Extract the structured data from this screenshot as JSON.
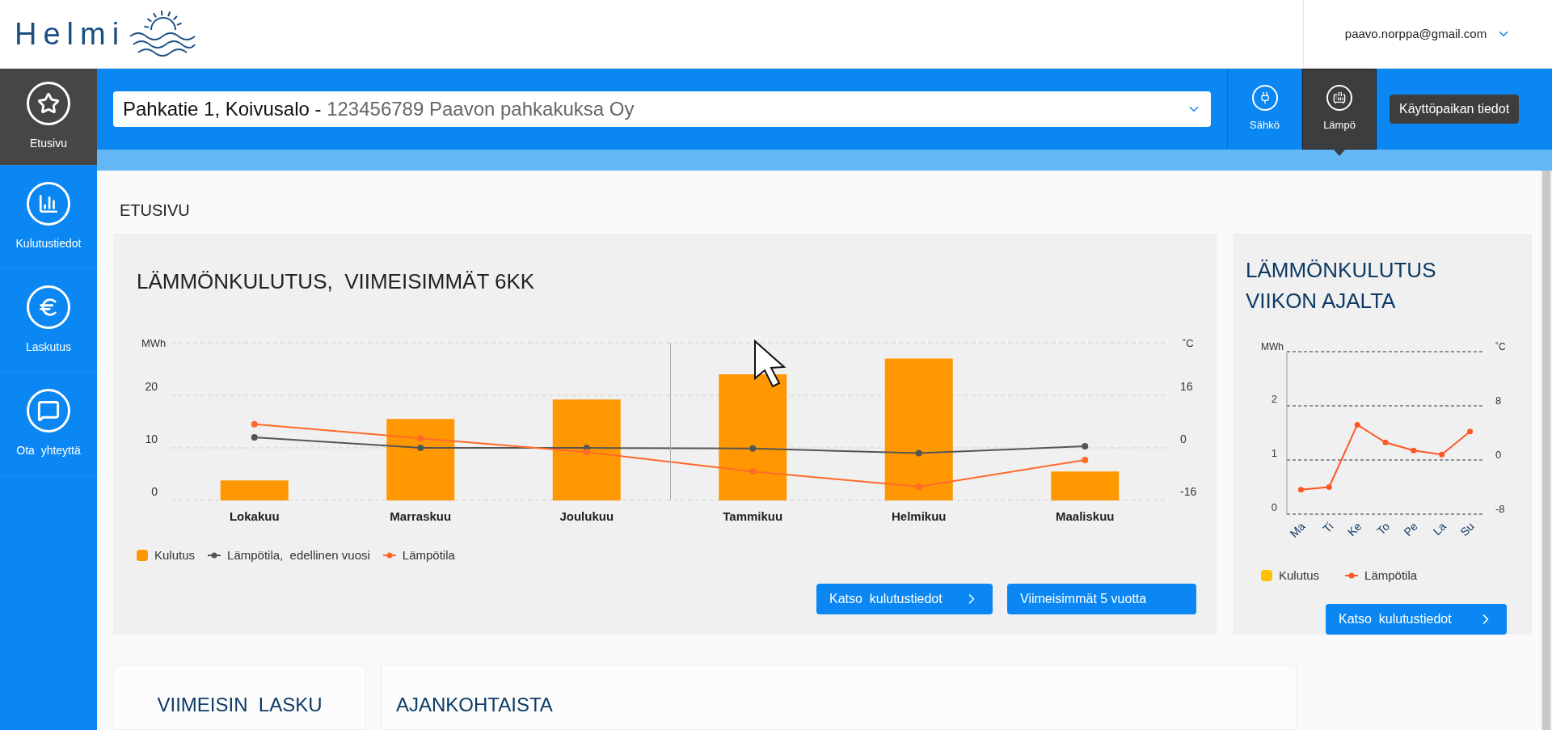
{
  "header": {
    "logo_text": "Helmi",
    "user_email": "paavo.norppa@gmail.com"
  },
  "sidebar": {
    "items": [
      {
        "label": "Etusivu",
        "selected": true
      },
      {
        "label": "Kulutustiedot",
        "selected": false
      },
      {
        "label": "Laskutus",
        "selected": false
      },
      {
        "label": "Ota  yhteyttä",
        "selected": false
      }
    ]
  },
  "location_select": {
    "address": "Pahkatie 1, Koivusalo -",
    "customer": "123456789 Paavon pahkakuksa Oy"
  },
  "energy_tabs": [
    {
      "label": "Sähkö",
      "selected": false
    },
    {
      "label": "Lämpö",
      "selected": true
    }
  ],
  "site_info_button": "Käyttöpaikan tiedot",
  "page_title": "ETUSIVU",
  "monthly_card": {
    "title": "LÄMMÖNKULUTUS,  VIIMEISIMMÄT 6KK",
    "chart_data": {
      "type": "bar",
      "ylabel": "MWh",
      "y2label": "˚C",
      "categories": [
        "Lokakuu",
        "Marraskuu",
        "Joulukuu",
        "Tammikuu",
        "Helmikuu",
        "Maaliskuu"
      ],
      "ylim": [
        0,
        30
      ],
      "yticks": [
        0,
        10,
        20
      ],
      "y2lim": [
        -16,
        32
      ],
      "y2ticks": [
        -16,
        0,
        16
      ],
      "series": [
        {
          "name": "Kulutus",
          "color": "#ff9800",
          "values": [
            3.8,
            15.5,
            19.2,
            24,
            27,
            5.5
          ]
        },
        {
          "name": "Lämpötila,  edellinen vuosi",
          "type": "line",
          "marker": true,
          "axis": "y2",
          "color": "#555555",
          "values": [
            3.2,
            0,
            0,
            -0.2,
            -1.6,
            0.5
          ]
        },
        {
          "name": "Lämpötila",
          "type": "line",
          "marker": true,
          "axis": "y2",
          "color": "#ff6a2a",
          "values": [
            7.2,
            2.9,
            -1.3,
            -7.2,
            -11.8,
            -3.7
          ]
        }
      ]
    },
    "buttons": [
      {
        "label": "Katso  kulutustiedot",
        "chevron": true
      },
      {
        "label": "Viimeisimmät 5 vuotta",
        "chevron": false
      }
    ]
  },
  "weekly_card": {
    "title": "LÄMMÖNKULUTUS VIIKON AJALTA",
    "chart_data": {
      "type": "line",
      "ylabel": "MWh",
      "y2label": "˚C",
      "categories": [
        "Ma",
        "Ti",
        "Ke",
        "To",
        "Pe",
        "La",
        "Su"
      ],
      "ylim": [
        0,
        3
      ],
      "yticks": [
        0,
        1,
        2
      ],
      "y2lim": [
        -8,
        16
      ],
      "y2ticks": [
        -8,
        0,
        8
      ],
      "series": [
        {
          "name": "Kulutus",
          "type": "bar",
          "color": "#ffc107",
          "values": [
            null,
            null,
            null,
            null,
            null,
            null,
            null
          ]
        },
        {
          "name": "Lämpötila",
          "marker": true,
          "axis": "y2",
          "color": "#ff5722",
          "values": [
            -4.4,
            -4,
            5.2,
            2.6,
            1.4,
            0.8,
            4.2
          ]
        }
      ]
    },
    "buttons": [
      {
        "label": "Katso  kulutustiedot",
        "chevron": true
      }
    ]
  },
  "bottom_cards": [
    {
      "title": "VIIMEISIN  LASKU"
    },
    {
      "title": "AJANKOHTAISTA"
    }
  ]
}
